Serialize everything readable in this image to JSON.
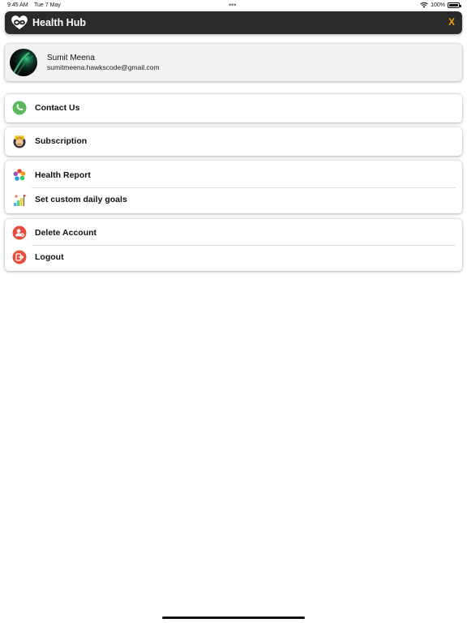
{
  "status_bar": {
    "time": "9:45 AM",
    "date": "Tue 7 May",
    "battery": "100%"
  },
  "header": {
    "title": "Health Hub",
    "close_label": "X",
    "accent_color": "#f5a300",
    "background_color": "#2b2b2b"
  },
  "profile": {
    "name": "Sumit Meena",
    "email": "sumitmeena.hawkscode@gmail.com"
  },
  "menu": {
    "contact": {
      "label": "Contact Us",
      "icon": "phone-icon"
    },
    "subscription": {
      "label": "Subscription",
      "icon": "subscription-icon"
    },
    "health_report": {
      "label": "Health Report",
      "icon": "health-report-icon"
    },
    "daily_goals": {
      "label": "Set custom daily goals",
      "icon": "goals-icon"
    },
    "delete_account": {
      "label": "Delete Account",
      "icon": "delete-account-icon"
    },
    "logout": {
      "label": "Logout",
      "icon": "logout-icon"
    }
  }
}
